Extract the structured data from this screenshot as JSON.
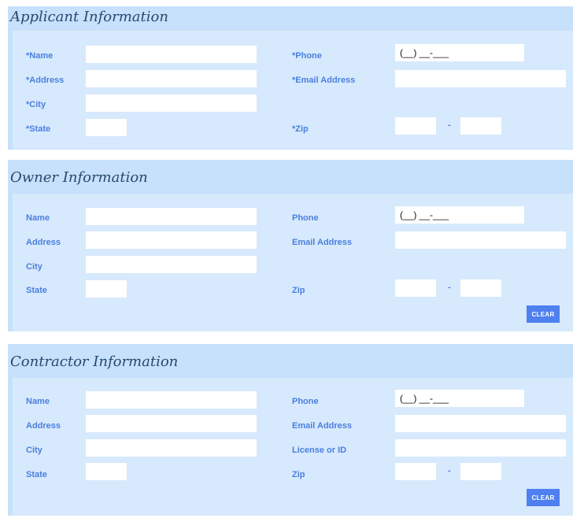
{
  "applicant": {
    "title": "Applicant Information",
    "labels": {
      "name": "*Name",
      "address": "*Address",
      "city": "*City",
      "state": "*State",
      "phone": "*Phone",
      "email": "*Email Address",
      "zip": "*Zip"
    },
    "phone_placeholder": "(__) __-___",
    "zip_separator": "-"
  },
  "owner": {
    "title": "Owner Information",
    "labels": {
      "name": "Name",
      "address": "Address",
      "city": "City",
      "state": "State",
      "phone": "Phone",
      "email": "Email Address",
      "zip": "Zip"
    },
    "phone_placeholder": "(__) __-___",
    "zip_separator": "-",
    "clear_label": "CLEAR"
  },
  "contractor": {
    "title": "Contractor Information",
    "labels": {
      "name": "Name",
      "address": "Address",
      "city": "City",
      "state": "State",
      "phone": "Phone",
      "email": "Email Address",
      "license": "License or ID",
      "zip": "Zip"
    },
    "phone_placeholder": "(__) __-___",
    "zip_separator": "-",
    "clear_label": "CLEAR"
  }
}
